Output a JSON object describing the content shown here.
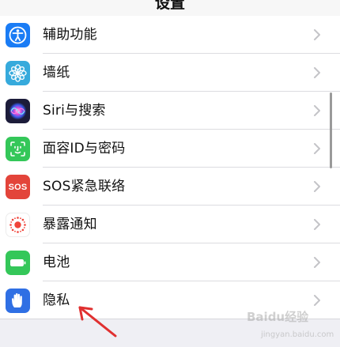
{
  "header": {
    "title": "设置"
  },
  "settings": {
    "items": [
      {
        "label": "辅助功能",
        "icon": "accessibility-icon",
        "color": "#1a7cf5"
      },
      {
        "label": "墙纸",
        "icon": "wallpaper-flower-icon",
        "color": "#36aadc"
      },
      {
        "label": "Siri与搜索",
        "icon": "siri-icon",
        "color": "#1c1c3a"
      },
      {
        "label": "面容ID与密码",
        "icon": "face-id-icon",
        "color": "#34c759"
      },
      {
        "label": "SOS紧急联络",
        "icon": "sos-icon",
        "color": "#e3443a"
      },
      {
        "label": "暴露通知",
        "icon": "exposure-notification-icon",
        "color": "#ffffff"
      },
      {
        "label": "电池",
        "icon": "battery-icon",
        "color": "#34c759"
      },
      {
        "label": "隐私",
        "icon": "hand-privacy-icon",
        "color": "#2f6fe4"
      }
    ]
  },
  "icons": {
    "sos_text": "SOS",
    "chevron": "chevron-right-icon"
  },
  "annotation": {
    "arrow_color": "#e03030"
  },
  "watermark": {
    "main": "Baidu经验",
    "sub": "jingyan.baidu.com"
  }
}
